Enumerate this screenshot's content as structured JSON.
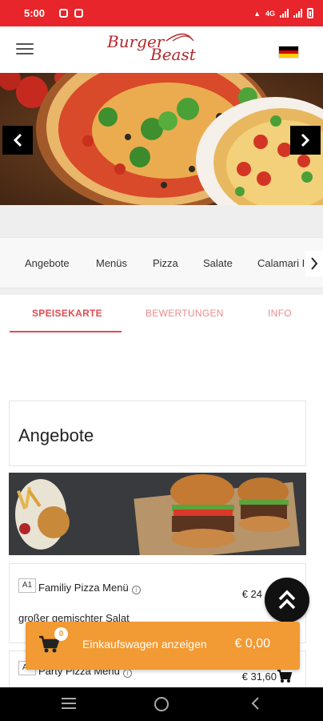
{
  "status_bar": {
    "time": "5:00",
    "network": "4G",
    "bg_color": "#e8252a"
  },
  "header": {
    "logo_text_1": "Burger",
    "logo_text_2": "Beast",
    "logo_color": "#b5292d",
    "language_flag": "de"
  },
  "hero": {
    "prev_icon": "chevron-left-icon",
    "next_icon": "chevron-right-icon"
  },
  "categories": [
    "Angebote",
    "Menüs",
    "Pizza",
    "Salate",
    "Calamari I"
  ],
  "tabs": [
    {
      "label": "SPEISEKARTE",
      "active": true
    },
    {
      "label": "BEWERTUNGEN",
      "active": false
    },
    {
      "label": "INFO",
      "active": false
    }
  ],
  "section": {
    "title": "Angebote"
  },
  "products": [
    {
      "code": "A1",
      "name": "Familiy Pizza Menü",
      "description": "großer gemischter Salat",
      "price": "€ 24"
    },
    {
      "code": "A2",
      "name": "Party Pizza Menü",
      "price": "€ 31,60"
    }
  ],
  "cart": {
    "count": "0",
    "label": "Einkaufswagen anzeigen",
    "total": "€ 0,00",
    "color": "#f29a33"
  },
  "accent_color": "#e44a50"
}
